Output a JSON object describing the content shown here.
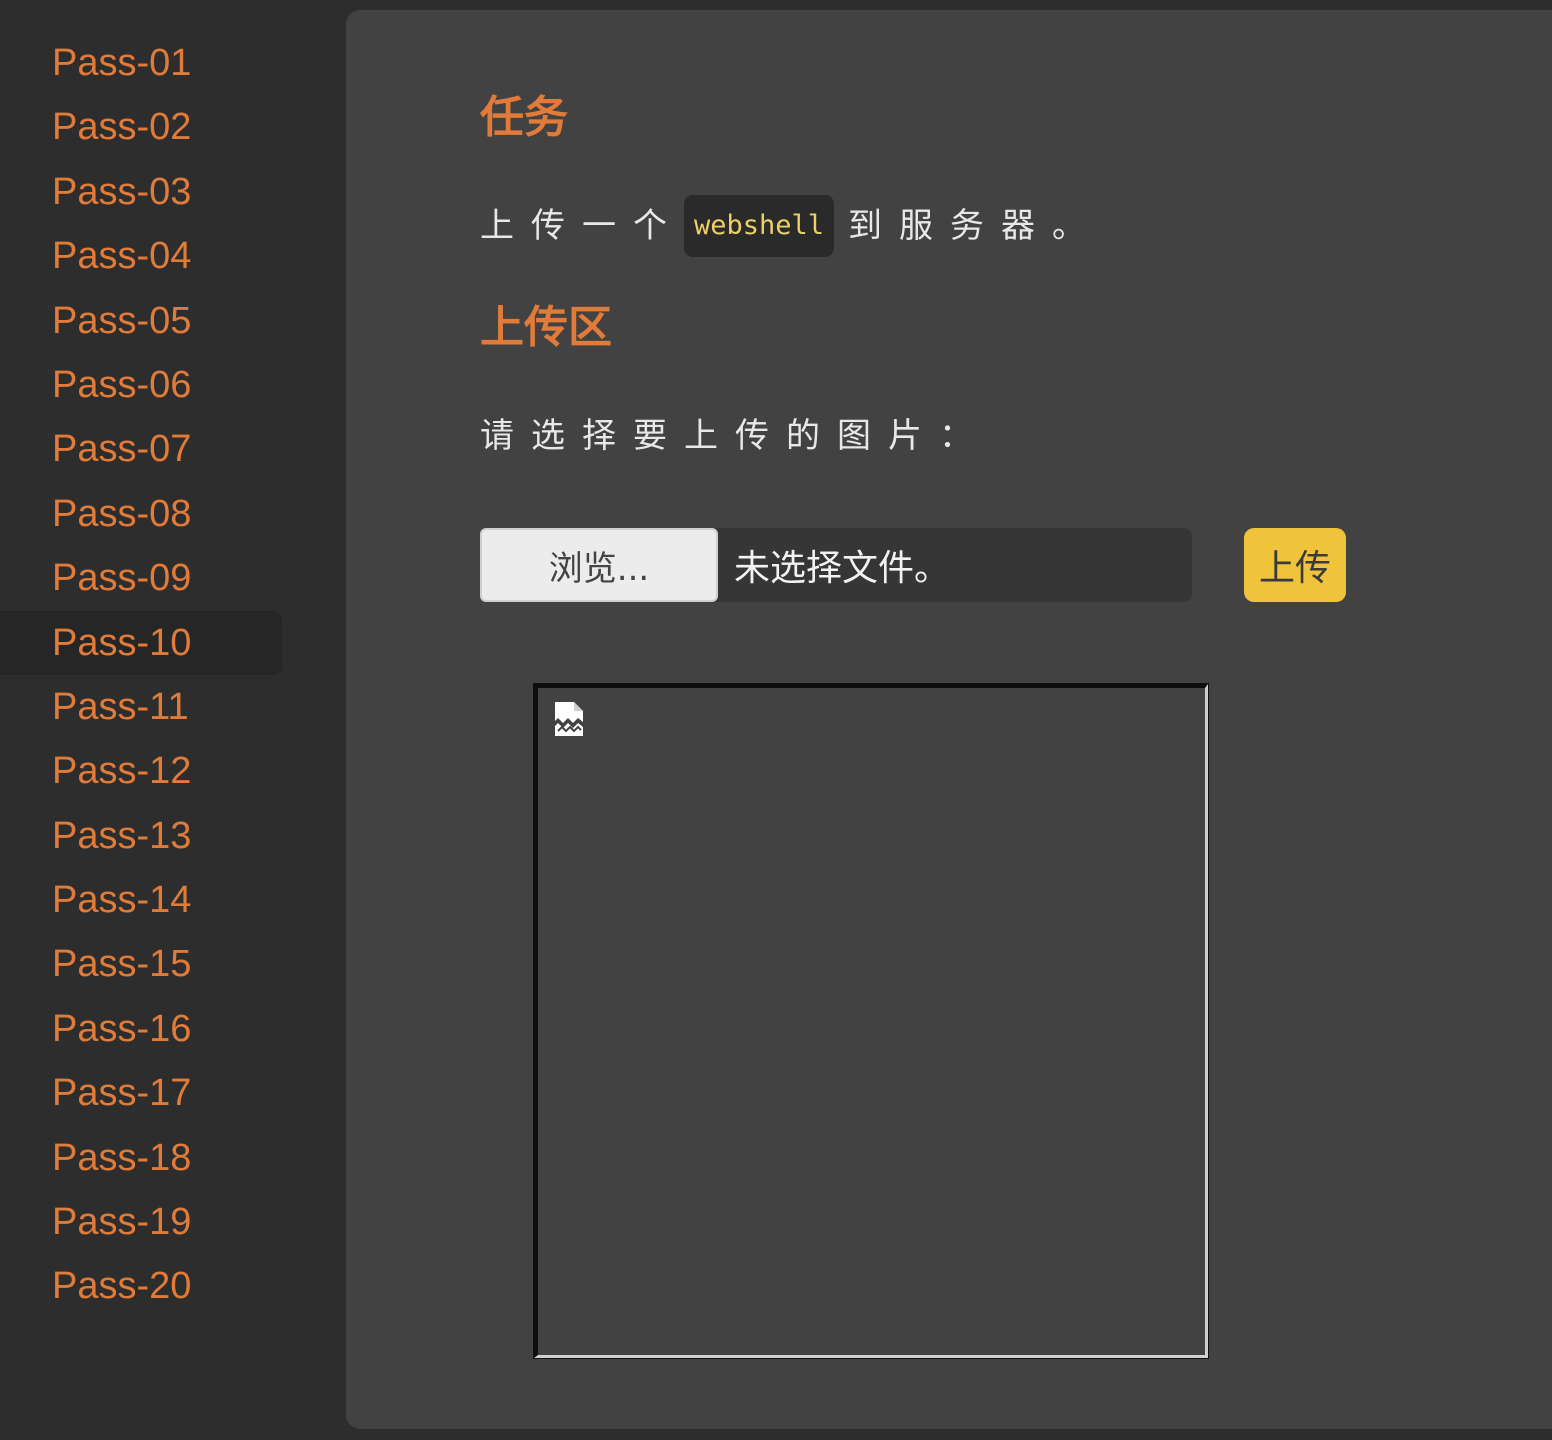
{
  "sidebar": {
    "items": [
      {
        "label": "Pass-01"
      },
      {
        "label": "Pass-02"
      },
      {
        "label": "Pass-03"
      },
      {
        "label": "Pass-04"
      },
      {
        "label": "Pass-05"
      },
      {
        "label": "Pass-06"
      },
      {
        "label": "Pass-07"
      },
      {
        "label": "Pass-08"
      },
      {
        "label": "Pass-09"
      },
      {
        "label": "Pass-10",
        "active": true
      },
      {
        "label": "Pass-11"
      },
      {
        "label": "Pass-12"
      },
      {
        "label": "Pass-13"
      },
      {
        "label": "Pass-14"
      },
      {
        "label": "Pass-15"
      },
      {
        "label": "Pass-16"
      },
      {
        "label": "Pass-17"
      },
      {
        "label": "Pass-18"
      },
      {
        "label": "Pass-19"
      },
      {
        "label": "Pass-20"
      }
    ]
  },
  "task": {
    "title": "任务",
    "text_before": "上传一个",
    "code": "webshell",
    "text_after": "到服务器。"
  },
  "upload": {
    "title": "上传区",
    "prompt": "请选择要上传的图片：",
    "browse_label": "浏览...",
    "file_status": "未选择文件。",
    "submit_label": "上传"
  },
  "preview": {
    "icon": "broken-image-icon"
  },
  "colors": {
    "accent": "#e07b39",
    "upload_button": "#f0c43a",
    "code_text": "#ead066",
    "panel_bg": "#424242",
    "page_bg": "#2d2d2d"
  }
}
